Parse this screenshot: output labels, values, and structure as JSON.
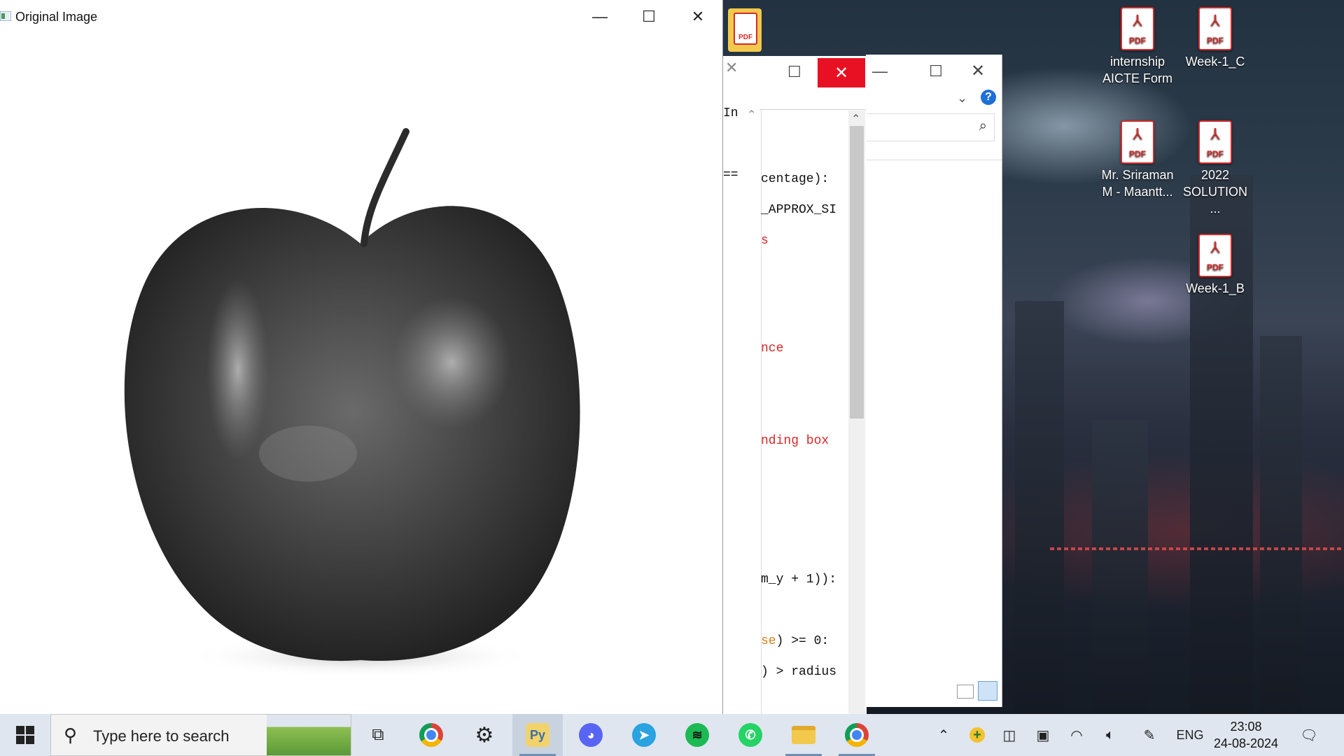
{
  "main_window": {
    "title": "Original Image",
    "controls": [
      "minimize",
      "maximize",
      "close"
    ],
    "content": "grayscale apple photo"
  },
  "code_window": {
    "gutter_text": [
      "In",
      "=="
    ],
    "lines": [
      {
        "text": "centage):",
        "color": "#111111"
      },
      {
        "text": "_APPROX_SI",
        "color": "#111111"
      },
      {
        "text": "s",
        "color": "#d62828"
      },
      {
        "text": "nce",
        "color": "#d62828"
      },
      {
        "text": "nding box",
        "color": "#d62828"
      },
      {
        "text": "m_y + 1)):",
        "color": "#111111"
      },
      {
        "text_orange": "se",
        "text_rest": ") >= 0:"
      },
      {
        "text": ") > radius",
        "color": "#111111"
      }
    ]
  },
  "desktop_icons": [
    {
      "label_line1": "internship",
      "label_line2": "AICTE Form",
      "type": "PDF"
    },
    {
      "label_line1": "Week-1_C",
      "label_line2": "",
      "type": "PDF"
    },
    {
      "label_line1": "Mr. Sriraman",
      "label_line2": "M - Maantt...",
      "type": "PDF"
    },
    {
      "label_line1": "2022",
      "label_line2": "SOLUTION ...",
      "type": "PDF"
    },
    {
      "label_line1": "Week-1_B",
      "label_line2": "",
      "type": "PDF"
    }
  ],
  "taskbar": {
    "search_placeholder": "Type here to search",
    "apps": [
      "task-view",
      "chrome",
      "settings",
      "python-idle",
      "discord",
      "telegram",
      "spotify",
      "whatsapp",
      "file-explorer",
      "chrome-profile"
    ],
    "language": "ENG",
    "time": "23:08",
    "date": "24-08-2024"
  },
  "colors": {
    "close_red": "#e81123",
    "pdf_red": "#d42b2b",
    "taskbar_bg": "#dfe6ef"
  }
}
